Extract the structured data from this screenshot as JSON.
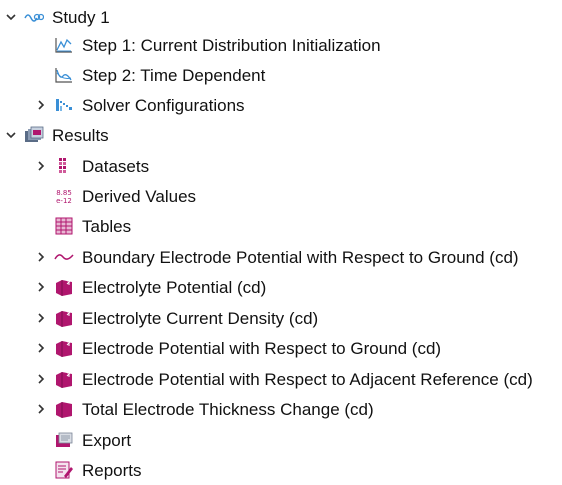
{
  "tree": {
    "study": {
      "label": "Study 1",
      "children": [
        {
          "label": "Step 1: Current Distribution Initialization",
          "icon": "stationary-step-icon"
        },
        {
          "label": "Step 2: Time Dependent",
          "icon": "time-dependent-step-icon"
        },
        {
          "label": "Solver Configurations",
          "icon": "solver-configurations-icon"
        }
      ]
    },
    "results": {
      "label": "Results",
      "children": [
        {
          "label": "Datasets",
          "icon": "datasets-icon"
        },
        {
          "label": "Derived Values",
          "icon": "derived-values-icon",
          "icon_text_top": "8.85",
          "icon_text_bottom": "e-12"
        },
        {
          "label": "Tables",
          "icon": "tables-icon"
        },
        {
          "label": "Boundary Electrode Potential with Respect to Ground (cd)",
          "icon": "1d-plot-icon"
        },
        {
          "label": "Electrolyte Potential (cd)",
          "icon": "3d-plot-group-icon"
        },
        {
          "label": "Electrolyte Current Density (cd)",
          "icon": "3d-plot-group-icon"
        },
        {
          "label": "Electrode Potential with Respect to Ground (cd)",
          "icon": "3d-plot-group-icon"
        },
        {
          "label": "Electrode Potential with Respect to Adjacent Reference (cd)",
          "icon": "3d-plot-group-icon"
        },
        {
          "label": "Total Electrode Thickness Change (cd)",
          "icon": "3d-plot-group-icon"
        },
        {
          "label": "Export",
          "icon": "export-icon"
        },
        {
          "label": "Reports",
          "icon": "reports-icon"
        }
      ]
    }
  },
  "colors": {
    "accent_blue": "#3a8fd6",
    "plot_magenta": "#b0166e",
    "chevron": "#444444"
  }
}
